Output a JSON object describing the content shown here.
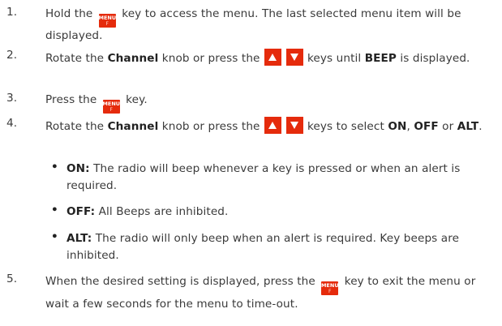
{
  "steps": [
    {
      "num": "1.",
      "seg": [
        "Hold the",
        "key to access the menu. The last selected menu item will be displayed."
      ]
    },
    {
      "num": "2.",
      "seg": [
        "Rotate the",
        "Channel",
        "knob or press the",
        "keys until",
        "BEEP",
        "is displayed."
      ]
    },
    {
      "num": "3.",
      "seg": [
        "Press the",
        "key."
      ]
    },
    {
      "num": "4.",
      "seg": [
        "Rotate the",
        "Channel",
        "knob or press the",
        "keys to select",
        "ON",
        ",",
        "OFF",
        "or",
        "ALT",
        "."
      ]
    },
    {
      "num": "5.",
      "seg": [
        "When the desired setting is displayed, press the",
        "key to exit the menu or wait a few seconds for the menu to time-out."
      ]
    }
  ],
  "bullets": [
    {
      "mark": "•",
      "term": "ON:",
      "text": "The radio will beep whenever a key is pressed or when an alert is required."
    },
    {
      "mark": "•",
      "term": "OFF:",
      "text": "All Beeps are inhibited."
    },
    {
      "mark": "•",
      "term": "ALT:",
      "text": "The radio will only beep when an alert is required. Key beeps are inhibited."
    }
  ],
  "menu_key": {
    "label": "MENU",
    "sublabel": "F",
    "color": "#e52b0c"
  },
  "icons": {
    "up_key": "up-arrow-key-icon",
    "down_key": "down-arrow-key-icon"
  }
}
